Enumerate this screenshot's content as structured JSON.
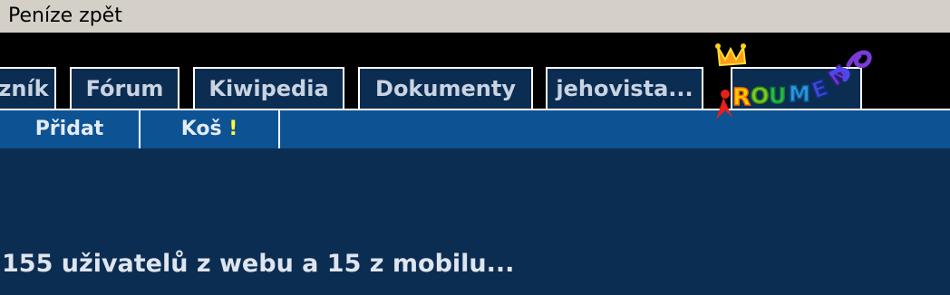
{
  "window": {
    "title": "Peníze zpět"
  },
  "nav": {
    "tabs": [
      {
        "label": "zník"
      },
      {
        "label": "Fórum"
      },
      {
        "label": "Kiwipedia"
      },
      {
        "label": "Dokumenty"
      },
      {
        "label": "jehovista..."
      }
    ],
    "logo": {
      "text": "ROUMEN",
      "icon": "roumen-logo-icon"
    }
  },
  "subnav": {
    "add_label": "Přidat",
    "trash_label": "Koš",
    "trash_alert": "!"
  },
  "main": {
    "online_text": "155 uživatelů z webu a 15 z mobilu..."
  },
  "colors": {
    "titlebar_bg": "#d4d0c8",
    "topbar_bg": "#000000",
    "tab_bg": "#0c2d52",
    "subbar_bg": "#0d5394",
    "main_bg": "#0c2d52",
    "alert": "#ffff33"
  }
}
